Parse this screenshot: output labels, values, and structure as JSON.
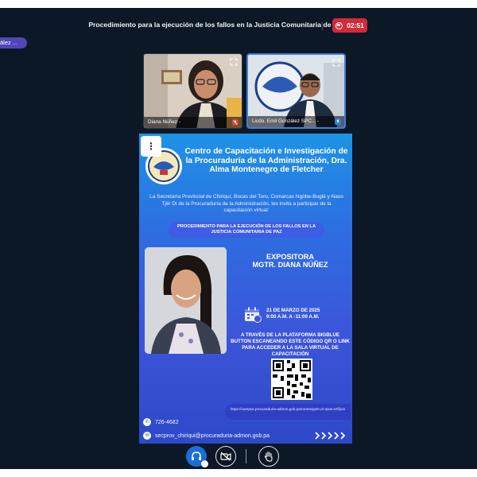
{
  "header": {
    "meeting_title": "Procedimiento para la ejecución de los fallos en la Justicia Comunitaria de Paz",
    "recording_time": "02:51",
    "user_chip": "ález ..."
  },
  "participants": [
    {
      "name": "Diana Núñez -",
      "mic_state": "muted"
    },
    {
      "name": "Licdo. Emil González SPC... -",
      "mic_state": "active"
    }
  ],
  "presentation": {
    "org_title": "Centro de Capacitación e Investigación de la Procuraduría de la Administración, Dra. Alma Montenegro de Fletcher",
    "invite_text": "La Secretaría Provincial de Chiriquí, Bocas del Toro, Comarcas Ngöbe-Buglé y Naso Tjër Di de la Procuraduría de la Administración, les invita a participar de la capacitación virtual:",
    "event_title": "PROCEDIMIENTO PARA LA EJECUCIÓN DE LOS FALLOS EN LA JUSTICIA COMUNITARIA DE PAZ",
    "speaker_heading": "EXPOSITORA",
    "speaker_name": "MGTR. DIANA NÚÑEZ",
    "event_date": "21 DE MARZO DE 2025",
    "event_time": "9:00 A.M. A -11:00 A.M.",
    "platform_text": "A TRAVÉS DE LA PLATAFORMA BIGBLUE BUTTON ESCANEANDO ESTE CÓDIGO QR O LINK PARA ACCEDER A LA SALA VIRTUAL DE CAPACITACIÓN",
    "link_text": "https://campus.procuraduria-admon.gob.pa/rooms/gu8-uir-qww-ezf/join",
    "phone": "726-4682",
    "email": "secprov_chiriqui@procuraduria-admon.gob.pa"
  },
  "controls": {
    "menu_glyph": "⋮"
  },
  "colors": {
    "background": "#0c1826",
    "recording": "#d32a39",
    "user_chip": "#5146b8",
    "active_speaker_border": "#3d7fdc",
    "audio_button": "#1a6fd6"
  },
  "icons": [
    "record-icon",
    "expand-icon",
    "mic-muted-icon",
    "mic-icon",
    "headphones-icon",
    "camera-off-icon",
    "raise-hand-icon",
    "calendar-icon",
    "phone-icon",
    "email-icon",
    "qr-code"
  ]
}
